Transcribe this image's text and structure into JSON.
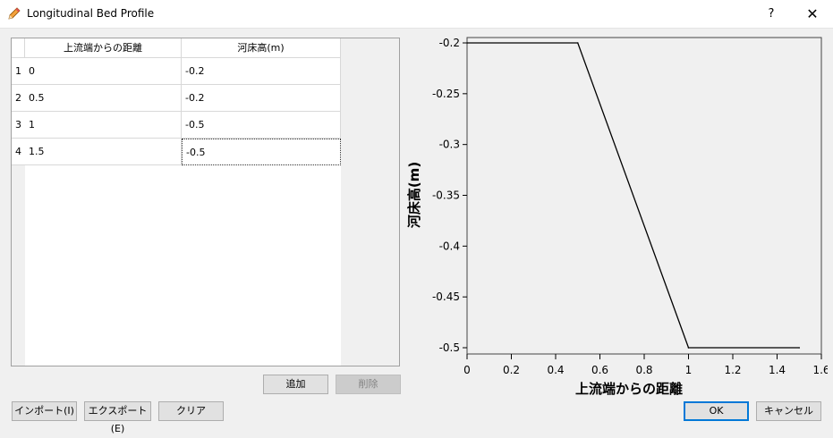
{
  "window": {
    "title": "Longitudinal Bed Profile",
    "help_label": "?",
    "close_label": "✕",
    "icon": "pencil-icon"
  },
  "table": {
    "headers": [
      "上流端からの距離",
      "河床高(m)"
    ],
    "rows": [
      {
        "num": "1",
        "dist": "0",
        "elev": "-0.2"
      },
      {
        "num": "2",
        "dist": "0.5",
        "elev": "-0.2"
      },
      {
        "num": "3",
        "dist": "1",
        "elev": "-0.5"
      },
      {
        "num": "4",
        "dist": "1.5",
        "elev": "-0.5"
      }
    ]
  },
  "buttons": {
    "add": "追加",
    "delete": "削除",
    "import": "インポート(I)",
    "export": "エクスポート(E)",
    "clear": "クリア",
    "ok": "OK",
    "cancel": "キャンセル"
  },
  "chart_data": {
    "type": "line",
    "title": "",
    "xlabel": "上流端からの距離",
    "ylabel": "河床高(m)",
    "xlim": [
      0,
      1.6
    ],
    "ylim": [
      -0.5,
      -0.2
    ],
    "xticks": [
      "0",
      "0.2",
      "0.4",
      "0.6",
      "0.8",
      "1",
      "1.2",
      "1.4",
      "1.6"
    ],
    "yticks": [
      "-0.2",
      "-0.25",
      "-0.3",
      "-0.35",
      "-0.4",
      "-0.45",
      "-0.5"
    ],
    "series": [
      {
        "x": [
          0,
          0.5,
          1,
          1.5
        ],
        "y": [
          -0.2,
          -0.2,
          -0.5,
          -0.5
        ],
        "color": "#000000"
      }
    ],
    "grid": false
  }
}
